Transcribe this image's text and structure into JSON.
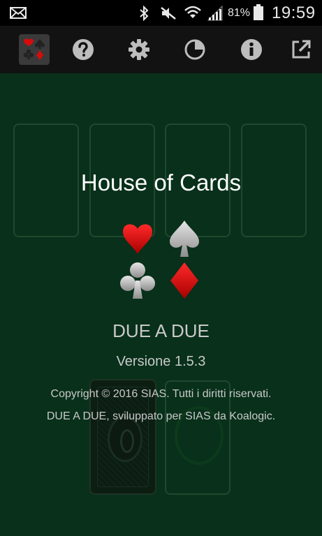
{
  "status_bar": {
    "battery_percent": "81%",
    "time": "19:59",
    "icons": [
      "mail-icon",
      "bluetooth-icon",
      "mute-icon",
      "wifi-icon",
      "signal-icon",
      "battery-icon"
    ]
  },
  "toolbar": {
    "buttons": [
      "game-icon",
      "help-icon",
      "settings-icon",
      "stats-icon",
      "info-icon",
      "share-icon"
    ],
    "active": "game-icon"
  },
  "about": {
    "title": "House of Cards",
    "app_name": "DUE A DUE",
    "version": "Versione 1.5.3",
    "copyright": "Copyright © 2016 SIAS. Tutti i diritti riservati.",
    "developer": "DUE A DUE, sviluppato per SIAS da Koalogic."
  },
  "colors": {
    "board": "#08301a",
    "heart": "#d60b0b",
    "diamond": "#d60b0b",
    "spade": "#bdbdbd",
    "club": "#bdbdbd"
  }
}
